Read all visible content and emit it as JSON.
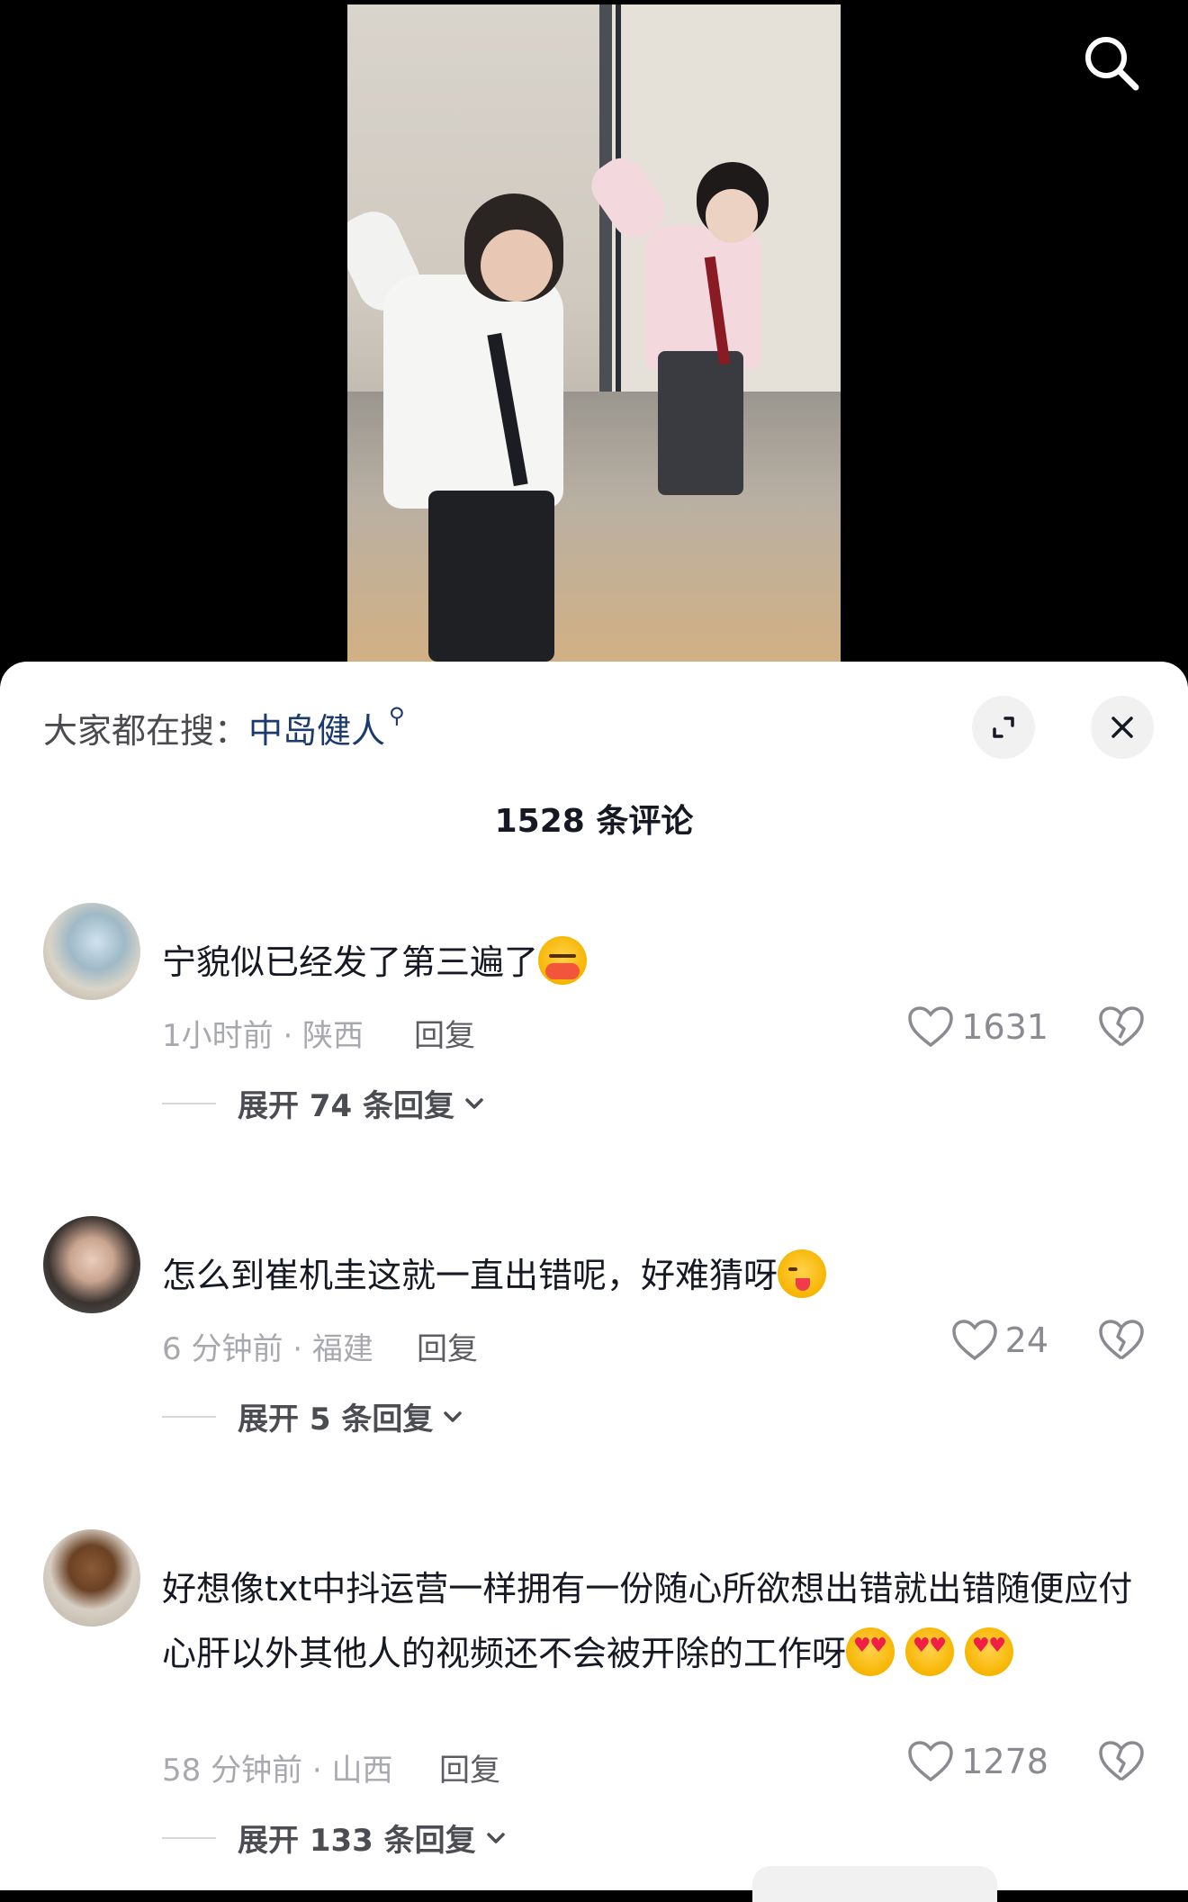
{
  "hot_search": {
    "label": "大家都在搜：",
    "term": "中岛健人"
  },
  "comments_header": {
    "title": "1528 条评论"
  },
  "comments": [
    {
      "text": "宁貌似已经发了第三遍了",
      "emojis": [
        "kiss-emoji"
      ],
      "time_location": "1小时前 · 陕西",
      "reply_label": "回复",
      "likes": "1631",
      "expand_label": "展开 74 条回复"
    },
    {
      "text": "怎么到崔机圭这就一直出错呢，好难猜呀",
      "emojis": [
        "wink-tongue-emoji"
      ],
      "time_location": "6 分钟前 · 福建",
      "reply_label": "回复",
      "likes": "24",
      "expand_label": "展开 5 条回复"
    },
    {
      "text": "好想像txt中抖运营一样拥有一份随心所欲想出错就出错随便应付心肝以外其他人的视频还不会被开除的工作呀",
      "emojis": [
        "heart-eyes-emoji",
        "heart-eyes-emoji",
        "heart-eyes-emoji"
      ],
      "time_location": "58 分钟前 · 山西",
      "reply_label": "回复",
      "likes": "1278",
      "expand_label": "展开 133 条回复"
    }
  ],
  "icons": {
    "search": "search-icon",
    "expand": "expand-icon",
    "close": "close-icon",
    "like": "heart-icon",
    "dislike": "broken-heart-icon",
    "chevron": "chevron-down-icon"
  },
  "colors": {
    "hot_term": "#1c3a6e",
    "panel_bg": "#ffffff",
    "meta_text": "#a8a9ae"
  }
}
